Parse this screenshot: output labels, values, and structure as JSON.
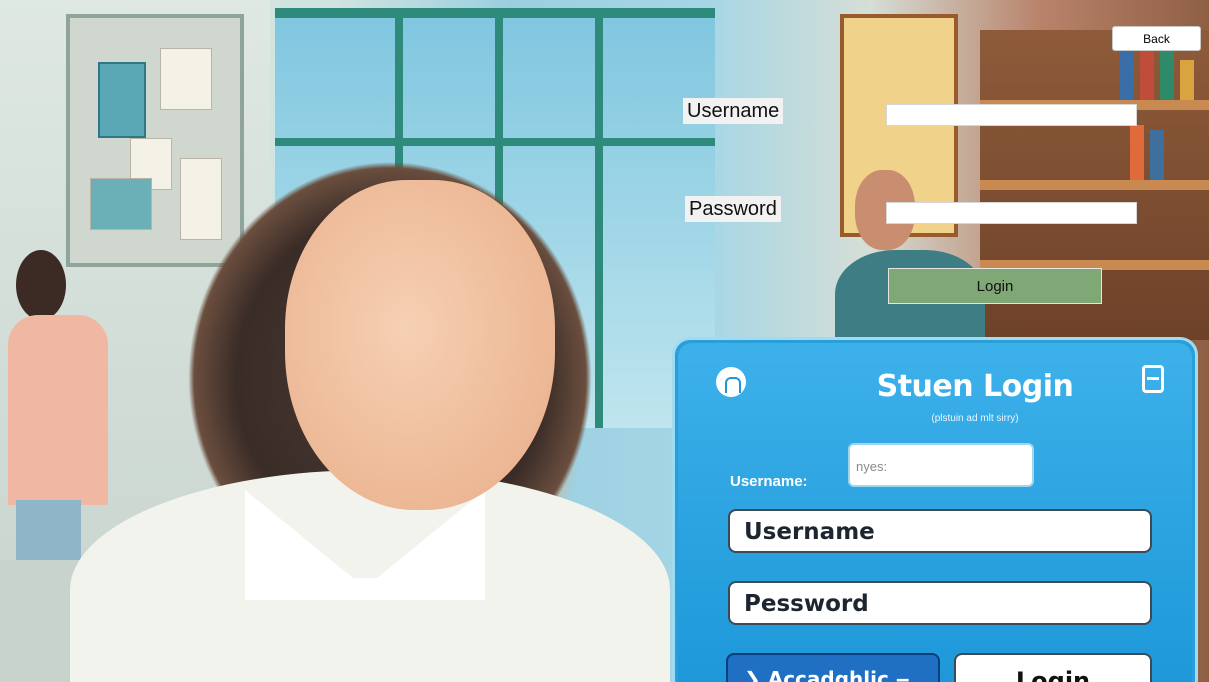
{
  "window": {
    "back_label": "Back"
  },
  "form": {
    "username_label": "Username",
    "password_label": "Password",
    "username_value": "",
    "password_value": "",
    "login_label": "Login"
  },
  "illustration_card": {
    "title": "Stuen Login",
    "subtitle": "(plstuin ad mlt sirry)",
    "small_username_label": "Username:",
    "small_input_text": "nyes:",
    "username_field": "Username",
    "password_field": "Pessword",
    "academic_button": "❯  Accadghlic  ‒",
    "login_button": "Login"
  },
  "colors": {
    "login_button_bg": "#80a877",
    "card_blue": "#2a9ed9"
  }
}
